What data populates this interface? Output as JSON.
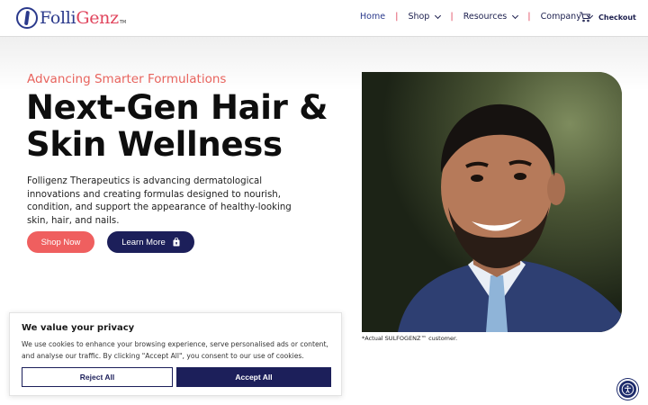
{
  "header": {
    "logo_text_left": "Folli",
    "logo_text_right": "Genz",
    "logo_tm": "TM",
    "nav": [
      {
        "label": "Home",
        "has_dropdown": false,
        "active": true
      },
      {
        "label": "Shop",
        "has_dropdown": true,
        "active": false
      },
      {
        "label": "Resources",
        "has_dropdown": true,
        "active": false
      },
      {
        "label": "Company",
        "has_dropdown": true,
        "active": false
      }
    ],
    "separator": "|",
    "checkout_label": "Checkout",
    "checkout_icon": "cart-icon"
  },
  "hero": {
    "eyebrow": "Advancing Smarter Formulations",
    "headline_line1": "Next-Gen Hair &",
    "headline_line2": "Skin Wellness",
    "lead": "Folligenz Therapeutics is advancing dermatological innovations and creating formulas designed to nourish, condition, and support the appearance of healthy-looking skin, hair, and nails.",
    "shop_button": "Shop Now",
    "learn_button": "Learn More",
    "learn_icon": "shopping-bag-icon",
    "photo_caption": "*Actual SULFOGENZ™ customer."
  },
  "cookie_banner": {
    "title": "We value your privacy",
    "text": "We use cookies to enhance your browsing experience, serve personalised ads or content, and analyse our traffic. By clicking \"Accept All\", you consent to our use of cookies.",
    "reject_label": "Reject All",
    "accept_label": "Accept All"
  },
  "accessibility_button_icon": "accessibility-icon",
  "colors": {
    "brand_navy": "#1c1f5a",
    "brand_coral": "#ef5f5f",
    "eyebrow": "#e8645e"
  }
}
